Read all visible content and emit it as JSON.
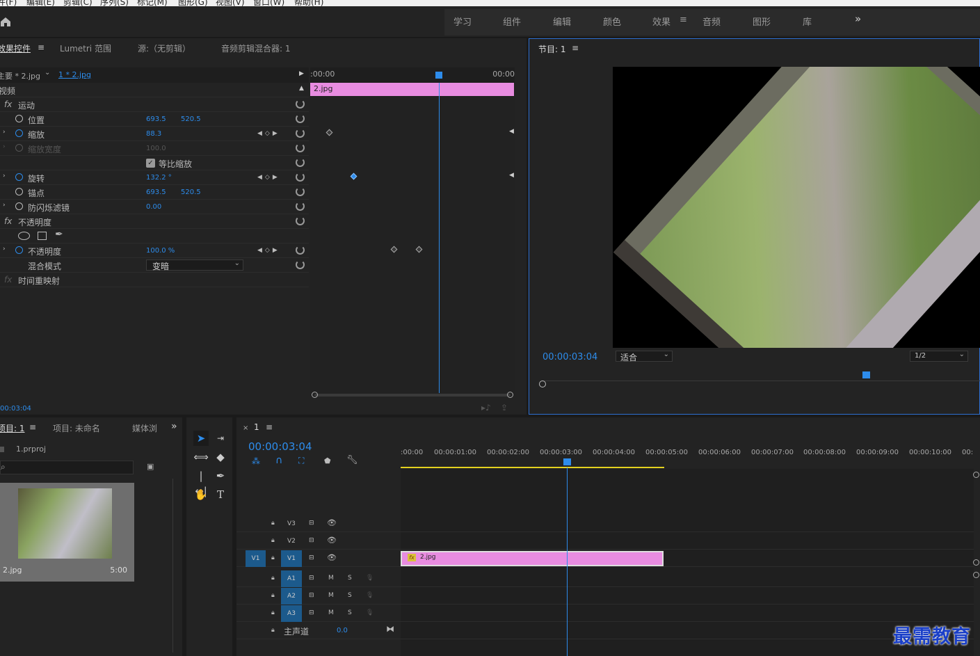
{
  "menubar": [
    "件(F)",
    "编辑(E)",
    "剪辑(C)",
    "序列(S)",
    "标记(M)",
    "图形(G)",
    "视图(V)",
    "窗口(W)",
    "帮助(H)"
  ],
  "workspaces": [
    "学习",
    "组件",
    "编辑",
    "颜色",
    "效果",
    "音频",
    "图形",
    "库"
  ],
  "workspace_active": "效果",
  "more": "»",
  "effect_panel": {
    "tabs": [
      "效果控件",
      "Lumetri 范围",
      "源:（无剪辑）",
      "音频剪辑混合器: 1"
    ],
    "menu_icon": "≡",
    "master": "主要 * 2.jpg",
    "sequence": "1 * 2.jpg",
    "section": "视频",
    "time_start": ":00:00",
    "time_end": "00:00",
    "clip": "2.jpg",
    "rows": {
      "motion": "运动",
      "position": "位置",
      "position_x": "693.5",
      "position_y": "520.5",
      "scale": "缩放",
      "scale_v": "88.3",
      "scale_w": "缩放宽度",
      "scale_w_v": "100.0",
      "uniform": "等比缩放",
      "rotation": "旋转",
      "rotation_v": "132.2 °",
      "anchor": "锚点",
      "anchor_x": "693.5",
      "anchor_y": "520.5",
      "flicker": "防闪烁滤镜",
      "flicker_v": "0.00",
      "opacity_fx": "不透明度",
      "opacity": "不透明度",
      "opacity_v": "100.0 %",
      "blend": "混合模式",
      "blend_v": "变暗",
      "remap": "时间重映射"
    },
    "timecode": "00:03:04"
  },
  "program": {
    "title": "节目: 1",
    "timecode": "00:00:03:04",
    "fit": "适合",
    "quality": "1/2"
  },
  "project": {
    "tabs": [
      "项目: 1",
      "项目: 未命名",
      "媒体浏"
    ],
    "file": "1.prproj",
    "item_name": "2.jpg",
    "item_dur": "5:00"
  },
  "timeline": {
    "tab": "1",
    "timecode": "00:00:03:04",
    "ruler": [
      ":00:00",
      "00:00:01:00",
      "00:00:02:00",
      "00:00:03:00",
      "00:00:04:00",
      "00:00:05:00",
      "00:00:06:00",
      "00:00:07:00",
      "00:00:08:00",
      "00:00:09:00",
      "00:00:10:00",
      "00:"
    ],
    "tracks": [
      "V3",
      "V2",
      "V1",
      "A1",
      "A2",
      "A3"
    ],
    "src": "V1",
    "m": "M",
    "s": "S",
    "master": "主声道",
    "master_v": "0.0",
    "clip": "2.jpg",
    "clip_fx": "fx"
  },
  "watermark": "最需教育",
  "fx_label": "fx",
  "colors": {
    "accent": "#2d8ceb",
    "clip": "#e88ce0",
    "panel": "#232323"
  }
}
